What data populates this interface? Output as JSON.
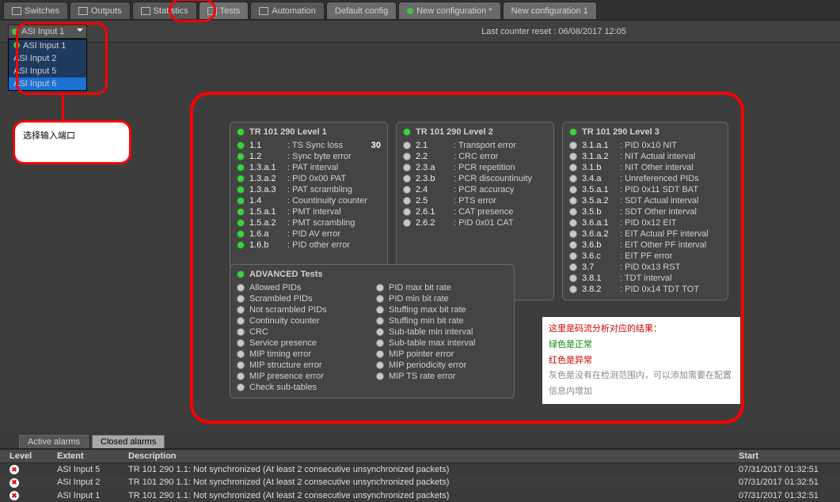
{
  "tabs": {
    "switches": "Switches",
    "outputs": "Outputs",
    "statistics": "Statistics",
    "tests": "Tests",
    "automation": "Automation",
    "default_config": "Default config",
    "new_config_star": "New configuration *",
    "new_config_1": "New configuration 1"
  },
  "reset_label": "Last counter reset : 06/08/2017 12:05",
  "dropdown": {
    "selected": "ASI Input 1",
    "options": [
      "ASI Input 1",
      "ASI Input 2",
      "ASI Input 5",
      "ASI Input 6"
    ]
  },
  "annot_select_label": "选择输入端口",
  "panels": {
    "l1": {
      "title": "TR 101 290 Level 1",
      "rows": [
        {
          "c": "1.1",
          "t": ": TS Sync loss",
          "cnt": "30",
          "i": "g"
        },
        {
          "c": "1.2",
          "t": ": Sync byte error",
          "i": "g"
        },
        {
          "c": "1.3.a.1",
          "t": ": PAT interval",
          "i": "g"
        },
        {
          "c": "1.3.a.2",
          "t": ": PID 0x00 PAT",
          "i": "g"
        },
        {
          "c": "1.3.a.3",
          "t": ": PAT scrambling",
          "i": "g"
        },
        {
          "c": "1.4",
          "t": ": Countinuity counter",
          "i": "g"
        },
        {
          "c": "1.5.a.1",
          "t": ": PMT interval",
          "i": "g"
        },
        {
          "c": "1.5.a.2",
          "t": ": PMT scrambling",
          "i": "g"
        },
        {
          "c": "1.6.a",
          "t": ": PID AV error",
          "i": "g"
        },
        {
          "c": "1.6.b",
          "t": ": PID other error",
          "i": "g"
        }
      ]
    },
    "l2": {
      "title": "TR 101 290 Level 2",
      "rows": [
        {
          "c": "2.1",
          "t": ": Transport error",
          "i": "w"
        },
        {
          "c": "2.2",
          "t": ": CRC error",
          "i": "w"
        },
        {
          "c": "2.3.a",
          "t": ": PCR repetition",
          "i": "w"
        },
        {
          "c": "2.3.b",
          "t": ": PCR discountinuity",
          "i": "w"
        },
        {
          "c": "2.4",
          "t": ": PCR accuracy",
          "i": "w"
        },
        {
          "c": "2.5",
          "t": ": PTS error",
          "i": "w"
        },
        {
          "c": "2.6.1",
          "t": ": CAT presence",
          "i": "w"
        },
        {
          "c": "2.6.2",
          "t": ": PID 0x01 CAT",
          "i": "w"
        }
      ]
    },
    "l3": {
      "title": "TR 101 290 Level 3",
      "rows": [
        {
          "c": "3.1.a.1",
          "t": ": PID 0x10 NIT",
          "i": "w"
        },
        {
          "c": "3.1.a.2",
          "t": ": NIT Actual interval",
          "i": "w"
        },
        {
          "c": "3.1.b",
          "t": ": NIT Other interval",
          "i": "w"
        },
        {
          "c": "3.4.a",
          "t": ": Unreferenced PIDs",
          "i": "w"
        },
        {
          "c": "3.5.a.1",
          "t": ": PID 0x11 SDT BAT",
          "i": "w"
        },
        {
          "c": "3.5.a.2",
          "t": ": SDT Actual interval",
          "i": "w"
        },
        {
          "c": "3.5.b",
          "t": ": SDT Other interval",
          "i": "w"
        },
        {
          "c": "3.6.a.1",
          "t": ": PID 0x12 EIT",
          "i": "w"
        },
        {
          "c": "3.6.a.2",
          "t": ": EIT Actual PF interval",
          "i": "w"
        },
        {
          "c": "3.6.b",
          "t": ": EIT Other PF interval",
          "i": "w"
        },
        {
          "c": "3.6.c",
          "t": ": EIT PF error",
          "i": "w"
        },
        {
          "c": "3.7",
          "t": ": PID 0x13 RST",
          "i": "w"
        },
        {
          "c": "3.8.1",
          "t": ": TDT interval",
          "i": "w"
        },
        {
          "c": "3.8.2",
          "t": ": PID 0x14 TDT TOT",
          "i": "w"
        }
      ]
    },
    "adv": {
      "title": "ADVANCED Tests",
      "col1": [
        "Allowed PIDs",
        "Scrambled PIDs",
        "Not scrambled PIDs",
        "Continuity counter",
        "CRC",
        "Service presence",
        "MIP timing error",
        "MIP structure error",
        "MIP presence error",
        "Check sub-tables"
      ],
      "col2": [
        "PID max bit rate",
        "PID min bit rate",
        "Stuffing max bit rate",
        "Stuffing min bit rate",
        "Sub-table min interval",
        "Sub-table max interval",
        "MIP pointer error",
        "MIP periodicity error",
        "MIP TS rate error"
      ]
    }
  },
  "notes": {
    "l1": "这里是码流分析对应的结果：",
    "l2": "绿色是正常",
    "l3": "红色是异常",
    "l4": "灰色是没有在检测范围内，可以添加需要在配置信息内增加"
  },
  "alarm_tabs": {
    "active": "Active alarms",
    "closed": "Closed alarms"
  },
  "grid": {
    "headers": {
      "level": "Level",
      "extent": "Extent",
      "desc": "Description",
      "start": "Start"
    },
    "rows": [
      {
        "ext": "ASI Input 5",
        "desc": "TR 101 290 1.1: Not synchronized (At least 2 consecutive unsynchronized packets)",
        "start": "07/31/2017 01:32:51"
      },
      {
        "ext": "ASI Input 2",
        "desc": "TR 101 290 1.1: Not synchronized (At least 2 consecutive unsynchronized packets)",
        "start": "07/31/2017 01:32:51"
      },
      {
        "ext": "ASI Input 1",
        "desc": "TR 101 290 1.1: Not synchronized (At least 2 consecutive unsynchronized packets)",
        "start": "07/31/2017 01:32:51"
      }
    ]
  }
}
